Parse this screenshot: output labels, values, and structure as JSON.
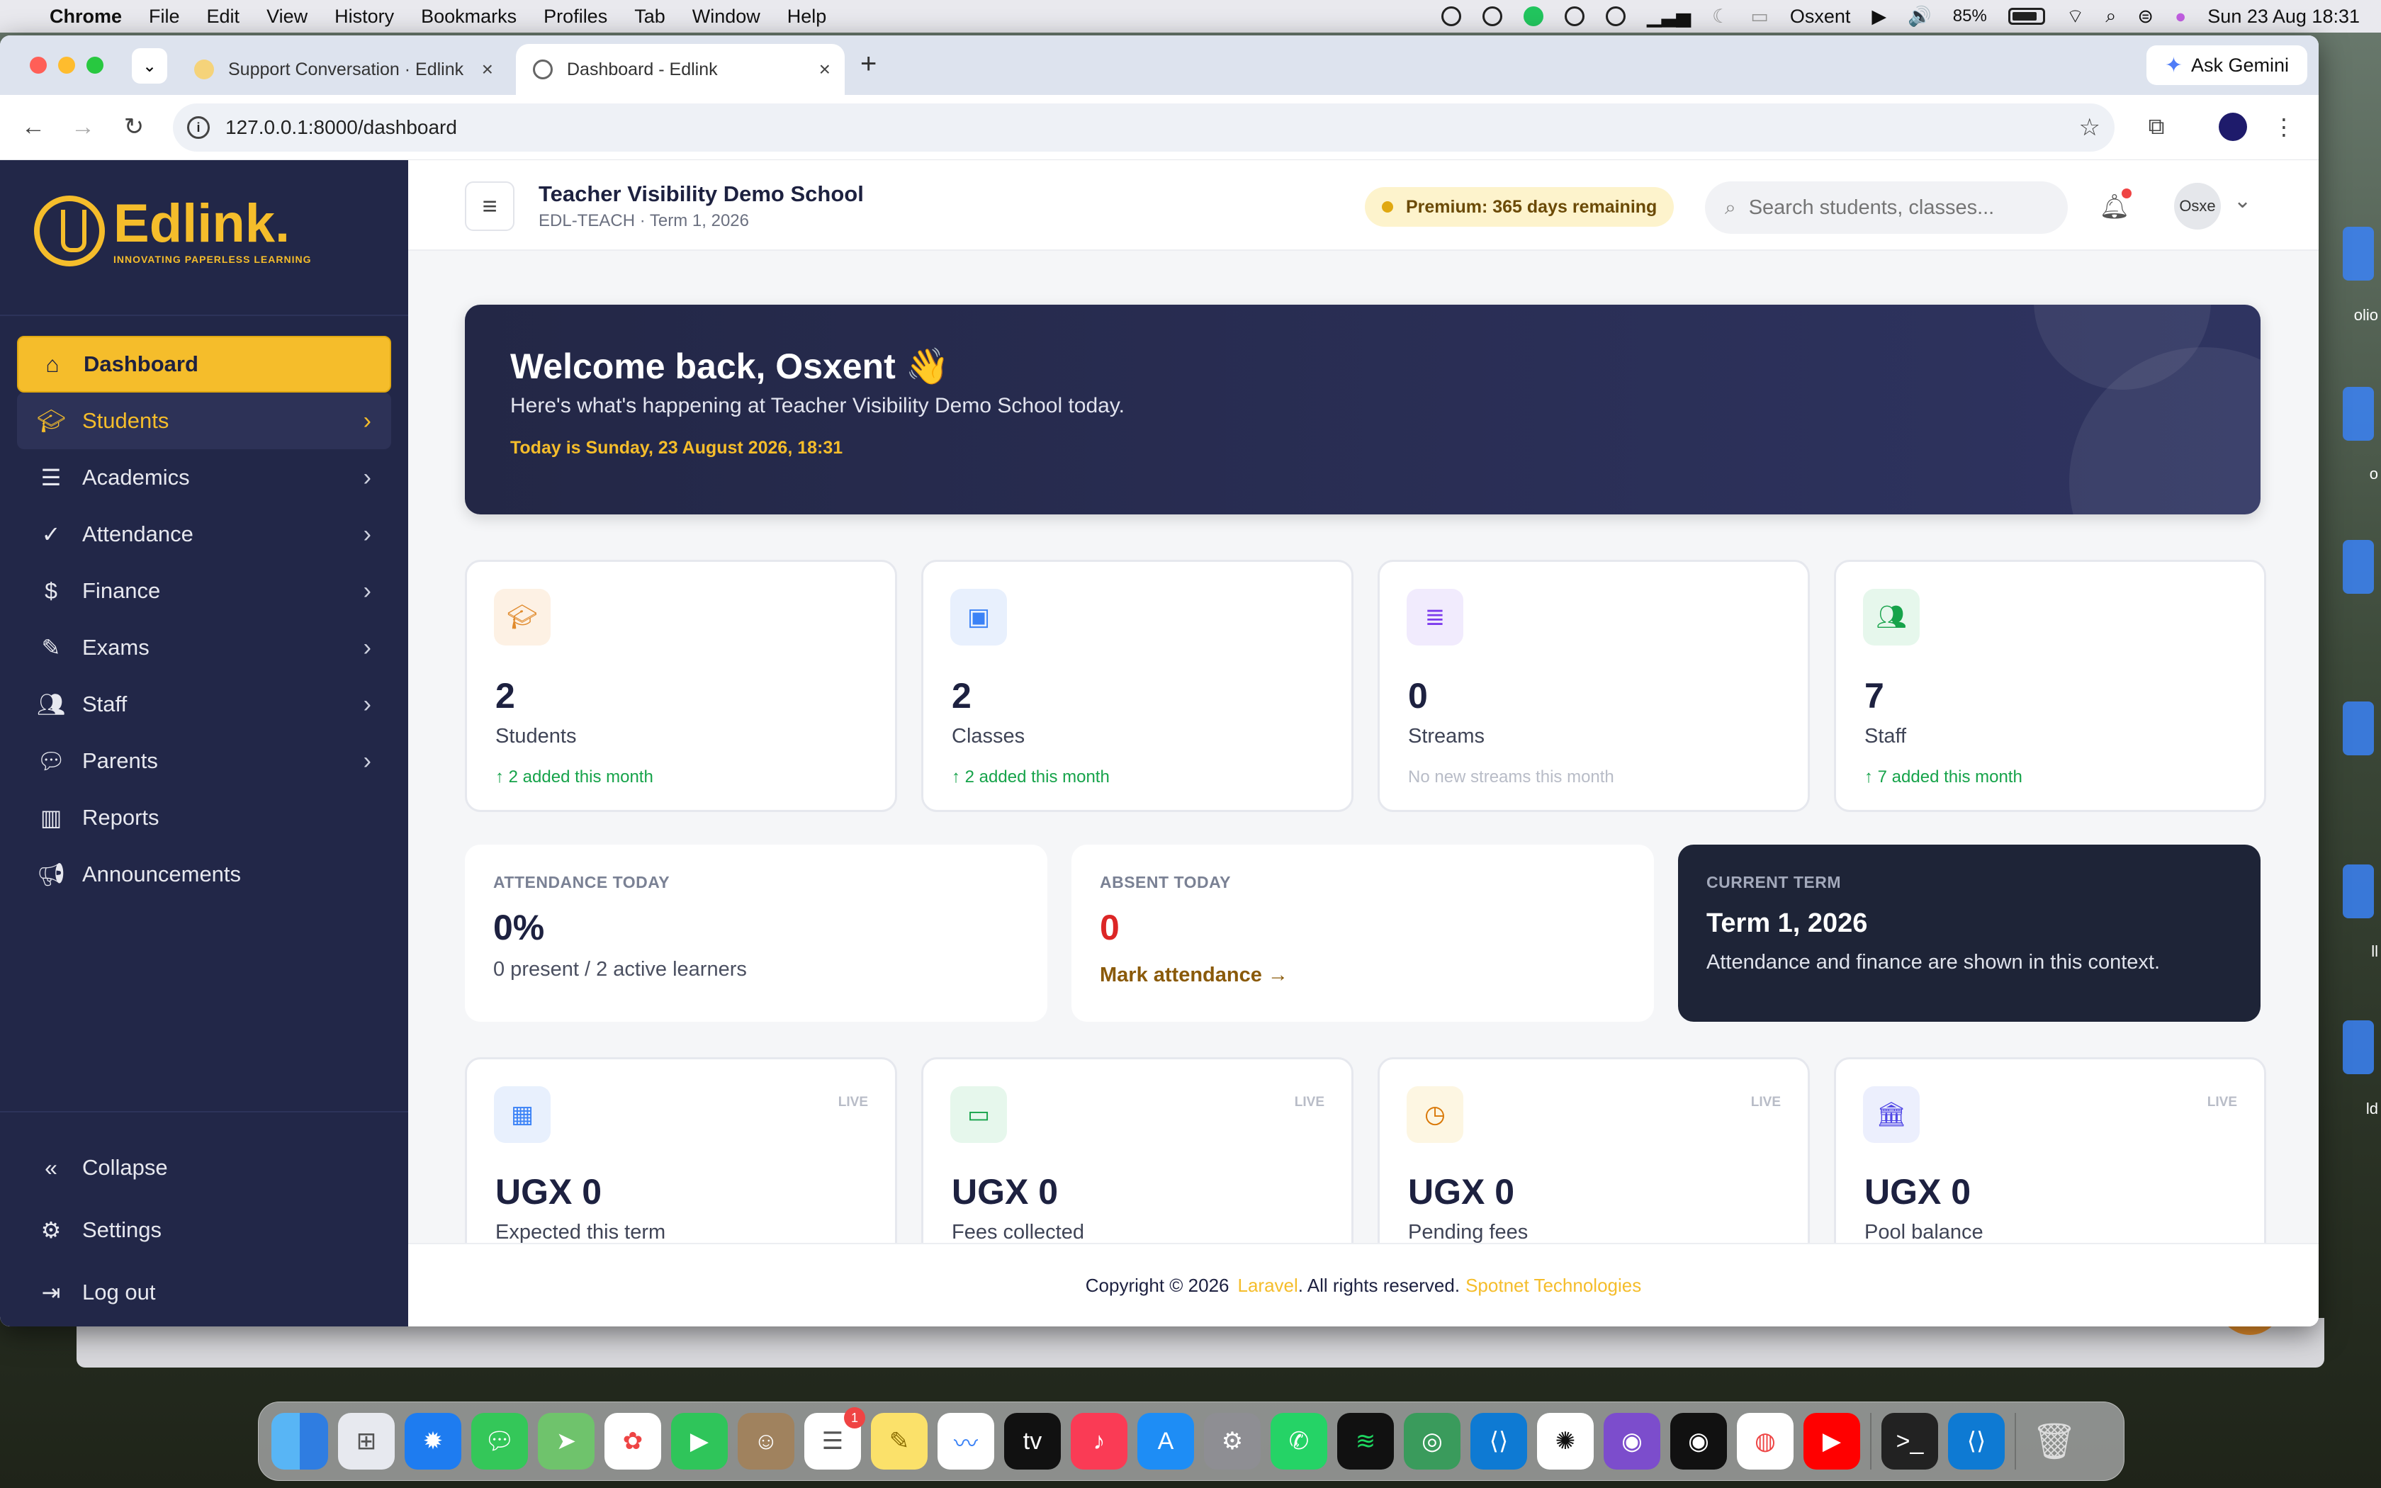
{
  "menubar": {
    "app": "Chrome",
    "items": [
      "File",
      "Edit",
      "View",
      "History",
      "Bookmarks",
      "Profiles",
      "Tab",
      "Window",
      "Help"
    ],
    "user": "Osxent",
    "battery": "85%",
    "datetime": "Sun 23 Aug  18:31"
  },
  "desktop": {
    "labels": [
      "olio",
      "o",
      "ll",
      "ld"
    ]
  },
  "browser": {
    "tabs": [
      {
        "title": "Support Conversation · Edlink",
        "active": false
      },
      {
        "title": "Dashboard - Edlink",
        "active": true
      }
    ],
    "new_tab": "+",
    "gemini": "Ask Gemini",
    "url": "127.0.0.1:8000/dashboard"
  },
  "sidebar": {
    "brand": "Edlink.",
    "tagline": "INNOVATING PAPERLESS LEARNING",
    "items": [
      {
        "label": "Dashboard",
        "icon": "home-icon",
        "state": "active",
        "chevron": false
      },
      {
        "label": "Students",
        "icon": "graduation-cap-icon",
        "state": "open",
        "chevron": true
      },
      {
        "label": "Academics",
        "icon": "list-icon",
        "state": "",
        "chevron": true
      },
      {
        "label": "Attendance",
        "icon": "check-circle-icon",
        "state": "",
        "chevron": true
      },
      {
        "label": "Finance",
        "icon": "dollar-circle-icon",
        "state": "",
        "chevron": true
      },
      {
        "label": "Exams",
        "icon": "pen-icon",
        "state": "",
        "chevron": true
      },
      {
        "label": "Staff",
        "icon": "users-icon",
        "state": "",
        "chevron": true
      },
      {
        "label": "Parents",
        "icon": "chat-icon",
        "state": "",
        "chevron": true
      },
      {
        "label": "Reports",
        "icon": "bar-chart-icon",
        "state": "",
        "chevron": false
      },
      {
        "label": "Announcements",
        "icon": "megaphone-icon",
        "state": "",
        "chevron": false
      }
    ],
    "bottom": [
      {
        "label": "Collapse",
        "icon": "collapse-icon"
      },
      {
        "label": "Settings",
        "icon": "gear-icon"
      },
      {
        "label": "Log out",
        "icon": "logout-icon"
      }
    ]
  },
  "header": {
    "school": "Teacher Visibility Demo School",
    "sub": "EDL-TEACH · Term 1, 2026",
    "premium": "Premium: 365 days remaining",
    "search_placeholder": "Search students, classes...",
    "avatar_text": "Osxe"
  },
  "hero": {
    "title": "Welcome back, Osxent 👋",
    "subtitle": "Here's what's happening at Teacher Visibility Demo School today.",
    "date": "Today is Sunday, 23 August 2026, 18:31"
  },
  "stats": [
    {
      "value": "2",
      "label": "Students",
      "trend": "↑ 2 added this month",
      "muted": false,
      "icon": "graduation-cap-icon",
      "bg": "#fdf1e4",
      "fg": "#e08a2c"
    },
    {
      "value": "2",
      "label": "Classes",
      "trend": "↑ 2 added this month",
      "muted": false,
      "icon": "box-icon",
      "bg": "#e8f0fd",
      "fg": "#3b82f6"
    },
    {
      "value": "0",
      "label": "Streams",
      "trend": "No new streams this month",
      "muted": true,
      "icon": "layers-icon",
      "bg": "#f1ebfd",
      "fg": "#7c3aed"
    },
    {
      "value": "7",
      "label": "Staff",
      "trend": "↑ 7 added this month",
      "muted": false,
      "icon": "users-icon",
      "bg": "#e6f7ec",
      "fg": "#16a34a"
    }
  ],
  "attendance": {
    "caption": "ATTENDANCE TODAY",
    "value": "0%",
    "detail": "0 present / 2 active learners"
  },
  "absent": {
    "caption": "ABSENT TODAY",
    "value": "0",
    "link": "Mark attendance →",
    "value_color": "#dc2626"
  },
  "term": {
    "caption": "CURRENT TERM",
    "value": "Term 1, 2026",
    "detail": "Attendance and finance are shown in this context."
  },
  "finance": [
    {
      "amount": "UGX 0",
      "label": "Expected this term",
      "live": "LIVE",
      "icon": "calculator-icon",
      "bg": "#e8f0fd",
      "fg": "#3b82f6"
    },
    {
      "amount": "UGX 0",
      "label": "Fees collected",
      "live": "LIVE",
      "icon": "cash-icon",
      "bg": "#e6f7ec",
      "fg": "#16a34a"
    },
    {
      "amount": "UGX 0",
      "label": "Pending fees",
      "live": "LIVE",
      "icon": "clock-icon",
      "bg": "#fdf6e2",
      "fg": "#d97706"
    },
    {
      "amount": "UGX 0",
      "label": "Pool balance",
      "live": "LIVE",
      "icon": "bank-icon",
      "bg": "#eceffd",
      "fg": "#4f46e5"
    }
  ],
  "footer": {
    "prefix": "Copyright © 2026",
    "laravel": "Laravel",
    "middle": ". All rights reserved.",
    "company": "Spotnet Technologies"
  },
  "colors": {
    "brand": "#f5bd2b",
    "sidebar": "#222748",
    "navy": "#1d2140"
  }
}
